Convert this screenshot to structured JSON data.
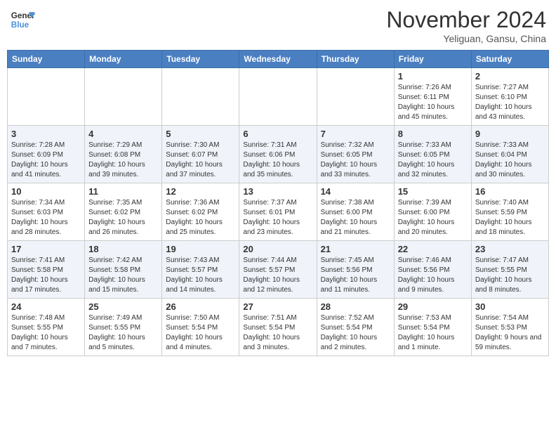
{
  "header": {
    "logo_line1": "General",
    "logo_line2": "Blue",
    "month": "November 2024",
    "location": "Yeliguan, Gansu, China"
  },
  "weekdays": [
    "Sunday",
    "Monday",
    "Tuesday",
    "Wednesday",
    "Thursday",
    "Friday",
    "Saturday"
  ],
  "weeks": [
    [
      {
        "day": "",
        "info": ""
      },
      {
        "day": "",
        "info": ""
      },
      {
        "day": "",
        "info": ""
      },
      {
        "day": "",
        "info": ""
      },
      {
        "day": "",
        "info": ""
      },
      {
        "day": "1",
        "info": "Sunrise: 7:26 AM\nSunset: 6:11 PM\nDaylight: 10 hours and 45 minutes."
      },
      {
        "day": "2",
        "info": "Sunrise: 7:27 AM\nSunset: 6:10 PM\nDaylight: 10 hours and 43 minutes."
      }
    ],
    [
      {
        "day": "3",
        "info": "Sunrise: 7:28 AM\nSunset: 6:09 PM\nDaylight: 10 hours and 41 minutes."
      },
      {
        "day": "4",
        "info": "Sunrise: 7:29 AM\nSunset: 6:08 PM\nDaylight: 10 hours and 39 minutes."
      },
      {
        "day": "5",
        "info": "Sunrise: 7:30 AM\nSunset: 6:07 PM\nDaylight: 10 hours and 37 minutes."
      },
      {
        "day": "6",
        "info": "Sunrise: 7:31 AM\nSunset: 6:06 PM\nDaylight: 10 hours and 35 minutes."
      },
      {
        "day": "7",
        "info": "Sunrise: 7:32 AM\nSunset: 6:05 PM\nDaylight: 10 hours and 33 minutes."
      },
      {
        "day": "8",
        "info": "Sunrise: 7:33 AM\nSunset: 6:05 PM\nDaylight: 10 hours and 32 minutes."
      },
      {
        "day": "9",
        "info": "Sunrise: 7:33 AM\nSunset: 6:04 PM\nDaylight: 10 hours and 30 minutes."
      }
    ],
    [
      {
        "day": "10",
        "info": "Sunrise: 7:34 AM\nSunset: 6:03 PM\nDaylight: 10 hours and 28 minutes."
      },
      {
        "day": "11",
        "info": "Sunrise: 7:35 AM\nSunset: 6:02 PM\nDaylight: 10 hours and 26 minutes."
      },
      {
        "day": "12",
        "info": "Sunrise: 7:36 AM\nSunset: 6:02 PM\nDaylight: 10 hours and 25 minutes."
      },
      {
        "day": "13",
        "info": "Sunrise: 7:37 AM\nSunset: 6:01 PM\nDaylight: 10 hours and 23 minutes."
      },
      {
        "day": "14",
        "info": "Sunrise: 7:38 AM\nSunset: 6:00 PM\nDaylight: 10 hours and 21 minutes."
      },
      {
        "day": "15",
        "info": "Sunrise: 7:39 AM\nSunset: 6:00 PM\nDaylight: 10 hours and 20 minutes."
      },
      {
        "day": "16",
        "info": "Sunrise: 7:40 AM\nSunset: 5:59 PM\nDaylight: 10 hours and 18 minutes."
      }
    ],
    [
      {
        "day": "17",
        "info": "Sunrise: 7:41 AM\nSunset: 5:58 PM\nDaylight: 10 hours and 17 minutes."
      },
      {
        "day": "18",
        "info": "Sunrise: 7:42 AM\nSunset: 5:58 PM\nDaylight: 10 hours and 15 minutes."
      },
      {
        "day": "19",
        "info": "Sunrise: 7:43 AM\nSunset: 5:57 PM\nDaylight: 10 hours and 14 minutes."
      },
      {
        "day": "20",
        "info": "Sunrise: 7:44 AM\nSunset: 5:57 PM\nDaylight: 10 hours and 12 minutes."
      },
      {
        "day": "21",
        "info": "Sunrise: 7:45 AM\nSunset: 5:56 PM\nDaylight: 10 hours and 11 minutes."
      },
      {
        "day": "22",
        "info": "Sunrise: 7:46 AM\nSunset: 5:56 PM\nDaylight: 10 hours and 9 minutes."
      },
      {
        "day": "23",
        "info": "Sunrise: 7:47 AM\nSunset: 5:55 PM\nDaylight: 10 hours and 8 minutes."
      }
    ],
    [
      {
        "day": "24",
        "info": "Sunrise: 7:48 AM\nSunset: 5:55 PM\nDaylight: 10 hours and 7 minutes."
      },
      {
        "day": "25",
        "info": "Sunrise: 7:49 AM\nSunset: 5:55 PM\nDaylight: 10 hours and 5 minutes."
      },
      {
        "day": "26",
        "info": "Sunrise: 7:50 AM\nSunset: 5:54 PM\nDaylight: 10 hours and 4 minutes."
      },
      {
        "day": "27",
        "info": "Sunrise: 7:51 AM\nSunset: 5:54 PM\nDaylight: 10 hours and 3 minutes."
      },
      {
        "day": "28",
        "info": "Sunrise: 7:52 AM\nSunset: 5:54 PM\nDaylight: 10 hours and 2 minutes."
      },
      {
        "day": "29",
        "info": "Sunrise: 7:53 AM\nSunset: 5:54 PM\nDaylight: 10 hours and 1 minute."
      },
      {
        "day": "30",
        "info": "Sunrise: 7:54 AM\nSunset: 5:53 PM\nDaylight: 9 hours and 59 minutes."
      }
    ]
  ]
}
